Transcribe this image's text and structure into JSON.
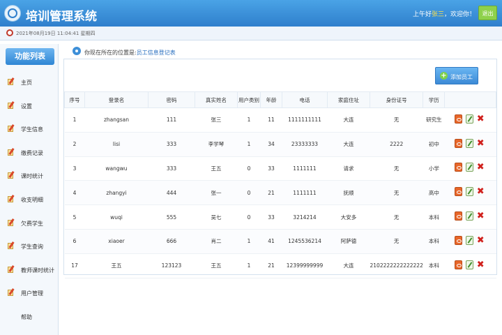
{
  "header": {
    "title": "培训管理系统",
    "greeting_prefix": "上午好",
    "username": "张三",
    "greeting_suffix": "，欢迎你！",
    "logout_label": "退出"
  },
  "datebar": {
    "datetime": "2021年08月19日 11:04:41 星期四"
  },
  "sidebar": {
    "title": "功能列表",
    "items": [
      "主页",
      "设置",
      "学生信息",
      "缴费记录",
      "课时统计",
      "收支明细",
      "欠费学生",
      "学生查询",
      "教师课时统计",
      "用户管理",
      "帮助"
    ]
  },
  "breadcrumb": {
    "prefix": "你现在所在的位置是:",
    "current": "员工信息登记表"
  },
  "toolbar": {
    "add_label": "添加员工"
  },
  "table": {
    "columns": [
      "序号",
      "登录名",
      "密码",
      "真实姓名",
      "用户类别",
      "年龄",
      "电话",
      "家庭住址",
      "身份证号",
      "学历",
      ""
    ],
    "rows": [
      [
        "1",
        "zhangsan",
        "111",
        "张三",
        "1",
        "11",
        "1111111111",
        "大连",
        "无",
        "研究生"
      ],
      [
        "2",
        "lisi",
        "333",
        "李学琴",
        "1",
        "34",
        "23333333",
        "大连",
        "2222",
        "初中"
      ],
      [
        "3",
        "wangwu",
        "333",
        "王五",
        "0",
        "33",
        "1111111",
        "请求",
        "无",
        "小学"
      ],
      [
        "4",
        "zhangyi",
        "444",
        "张一",
        "0",
        "21",
        "1111111",
        "抚顺",
        "无",
        "高中"
      ],
      [
        "5",
        "wuqi",
        "555",
        "吴七",
        "0",
        "33",
        "3214214",
        "大安多",
        "无",
        "本科"
      ],
      [
        "6",
        "xiaoer",
        "666",
        "肖二",
        "1",
        "41",
        "1245536214",
        "阿萨德",
        "无",
        "本科"
      ],
      [
        "17",
        "王五",
        "123123",
        "王五",
        "1",
        "21",
        "12399999999",
        "大连",
        "2102222222222222",
        "本科"
      ]
    ]
  },
  "colors": {
    "header_blue": "#2f7fcc",
    "logout_green": "#8ed14b",
    "delete_red": "#d0201c"
  }
}
